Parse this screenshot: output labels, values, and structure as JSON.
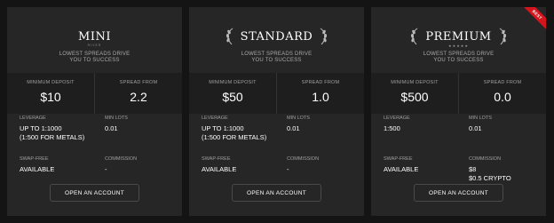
{
  "tagline": [
    "LOWEST SPREADS DRIVE",
    "YOU TO SUCCESS"
  ],
  "labels": {
    "minimum_deposit": "MINIMUM DEPOSIT",
    "spread_from": "SPREAD FROM",
    "leverage": "LEVERAGE",
    "min_lots": "MIN LOTS",
    "swap_free": "SWAP-FREE",
    "commission": "COMMISSION"
  },
  "button_label": "OPEN AN ACCOUNT",
  "colors": {
    "card": "#262626",
    "stats": "#1e1e1e",
    "ribbon": "#d5141c"
  },
  "accounts": [
    {
      "name": "MINI",
      "subtitle": "RIVER",
      "min_deposit": "$10",
      "spread_from": "2.2",
      "leverage": [
        "UP TO 1:1000",
        "(1:500 FOR METALS)"
      ],
      "min_lots": "0.01",
      "swap_free": "AVAILABLE",
      "commission": [
        "-"
      ]
    },
    {
      "name": "STANDARD",
      "min_deposit": "$50",
      "spread_from": "1.0",
      "leverage": [
        "UP TO 1:1000",
        "(1:500 FOR METALS)"
      ],
      "min_lots": "0.01",
      "swap_free": "AVAILABLE",
      "commission": [
        "-"
      ]
    },
    {
      "name": "PREMIUM",
      "stars": "★★★★★",
      "badge": "BEST",
      "min_deposit": "$500",
      "spread_from": "0.0",
      "leverage": [
        "1:500"
      ],
      "min_lots": "0.01",
      "swap_free": "AVAILABLE",
      "commission": [
        "$8",
        "$0.5 CRYPTO"
      ]
    }
  ]
}
